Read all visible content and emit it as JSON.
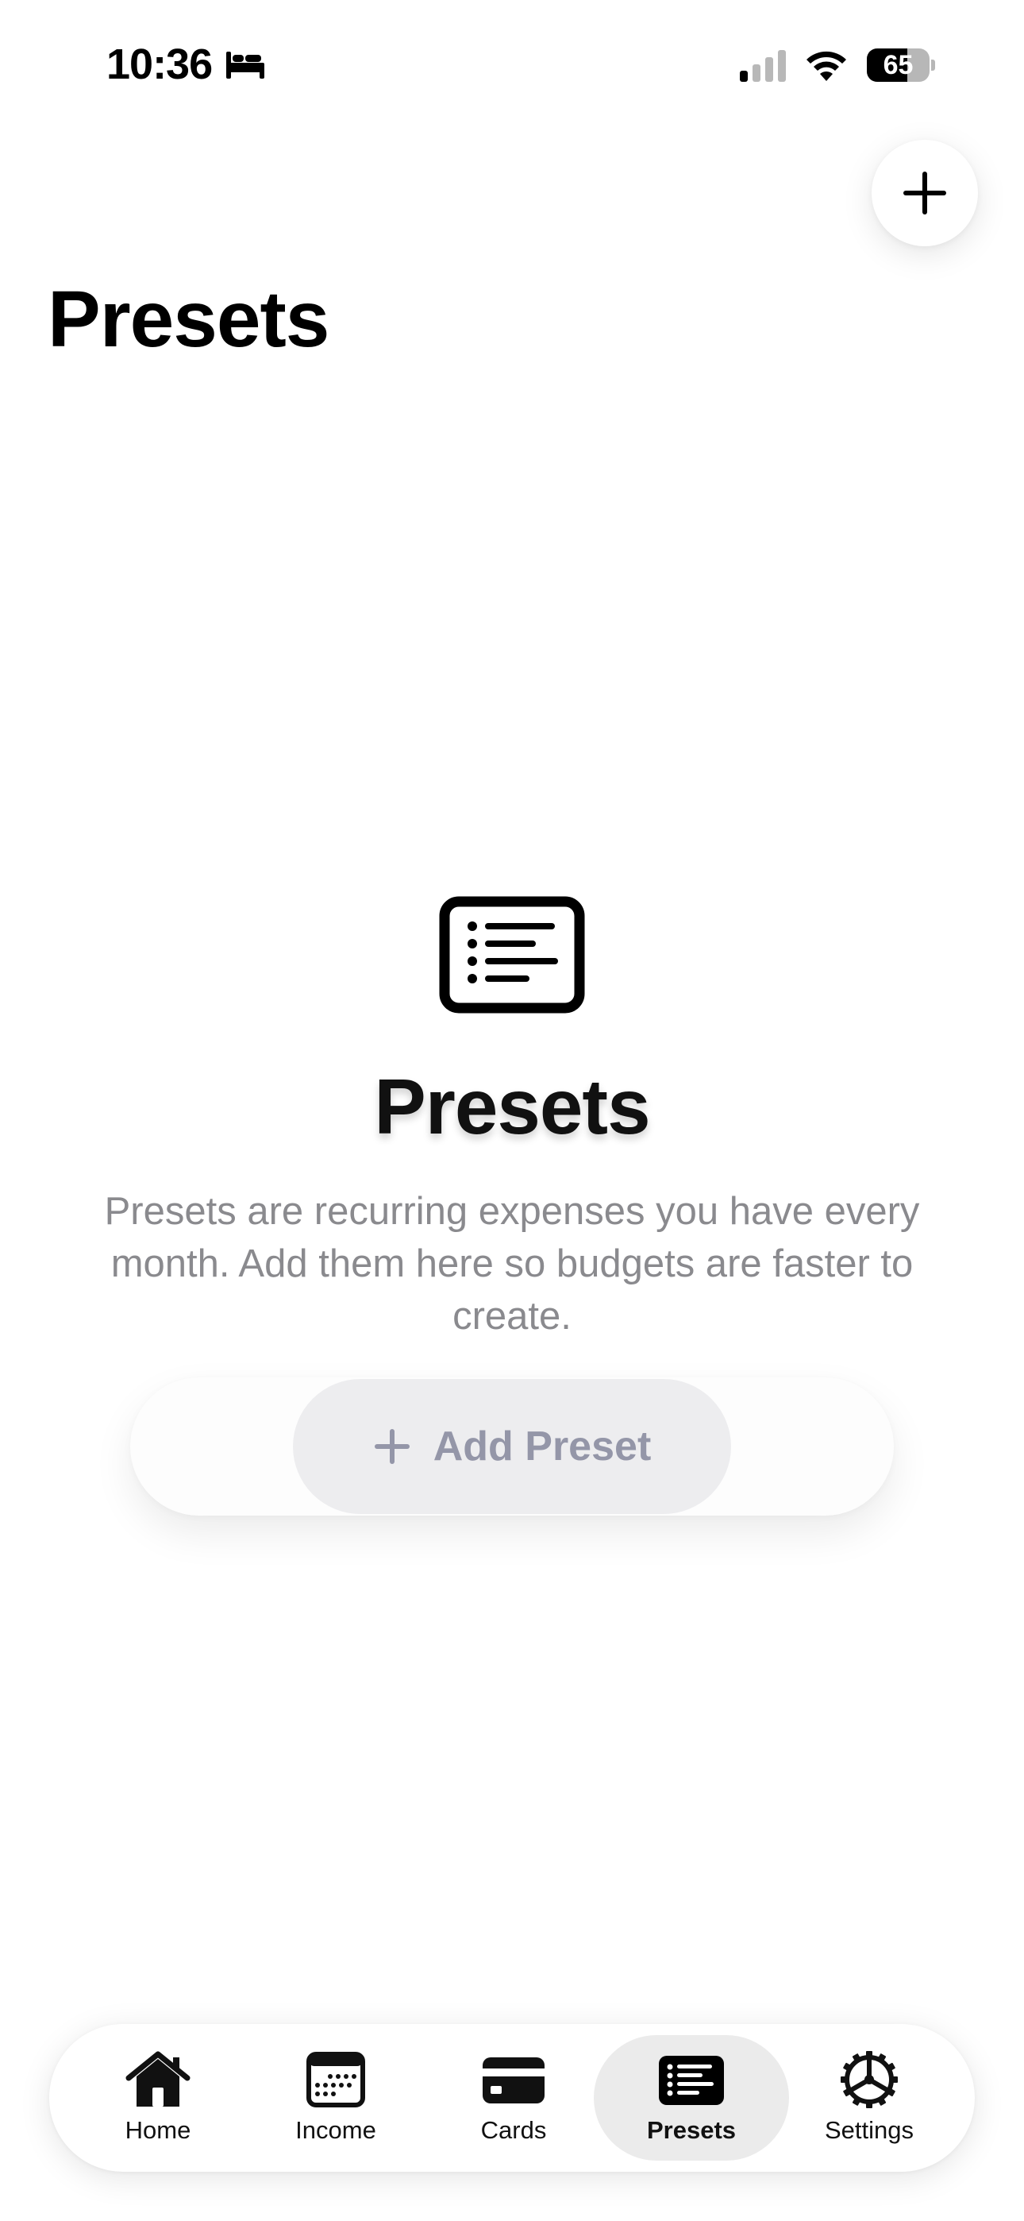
{
  "status_bar": {
    "time": "10:36",
    "battery_percent": "65",
    "battery_level": 0.65,
    "signal_bars_active": 1,
    "signal_bars_total": 4,
    "icons": [
      "bed-icon",
      "cellular-signal-icon",
      "wifi-icon",
      "battery-icon"
    ]
  },
  "header": {
    "title": "Presets",
    "add_button_icon": "plus-icon"
  },
  "empty_state": {
    "icon": "list-document-icon",
    "title": "Presets",
    "description": "Presets are recurring expenses you have every month. Add them here so budgets are faster to create.",
    "button_label": "Add Preset",
    "button_icon": "plus-icon"
  },
  "tab_bar": {
    "active_tab": "Presets",
    "tabs": [
      {
        "label": "Home",
        "icon": "house-icon"
      },
      {
        "label": "Income",
        "icon": "calendar-icon"
      },
      {
        "label": "Cards",
        "icon": "credit-card-icon"
      },
      {
        "label": "Presets",
        "icon": "list-icon"
      },
      {
        "label": "Settings",
        "icon": "gear-icon"
      }
    ]
  },
  "colors": {
    "background": "#ffffff",
    "text_primary": "#000000",
    "text_secondary": "#8a8a8e",
    "button_text": "#9496a8",
    "button_fill": "#ededef",
    "active_tab_fill": "#ebebeb"
  }
}
